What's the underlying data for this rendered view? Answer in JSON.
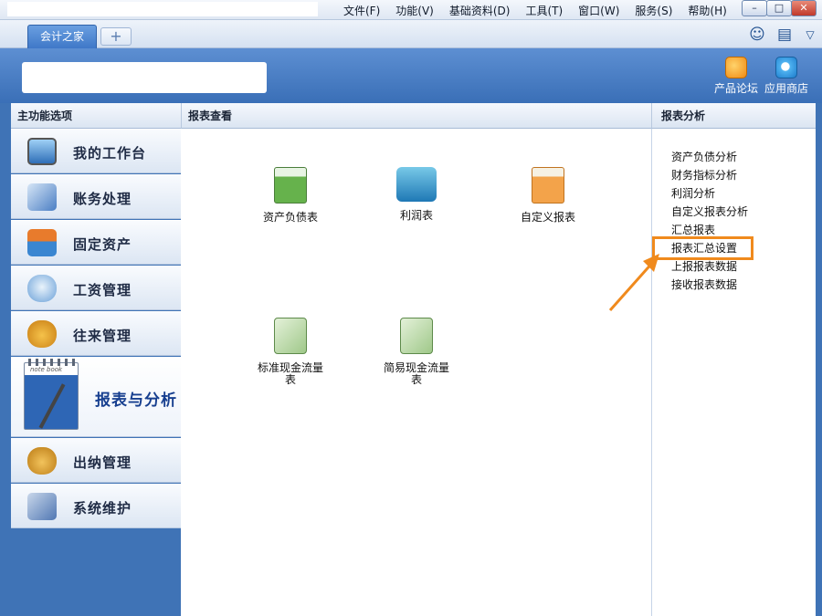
{
  "menubar": {
    "items": [
      "文件(F)",
      "功能(V)",
      "基础资料(D)",
      "工具(T)",
      "窗口(W)",
      "服务(S)",
      "帮助(H)"
    ]
  },
  "window_controls": {
    "minimize": "–",
    "maximize": "□",
    "close": "✕"
  },
  "tabbar": {
    "active_tab": "会计之家",
    "add_tab": "+",
    "icons": [
      "smiley-icon",
      "message-icon",
      "dropdown-icon"
    ]
  },
  "header": {
    "buttons": [
      {
        "label": "产品论坛",
        "icon": "forum-icon"
      },
      {
        "label": "应用商店",
        "icon": "app-store-icon"
      }
    ]
  },
  "panels": {
    "left_title": "主功能选项",
    "center_title": "报表查看",
    "right_title": "报表分析"
  },
  "sidebar": {
    "items": [
      {
        "label": "我的工作台",
        "icon": "monitor-icon"
      },
      {
        "label": "账务处理",
        "icon": "ledger-icon"
      },
      {
        "label": "固定资产",
        "icon": "house-icon"
      },
      {
        "label": "工资管理",
        "icon": "cloud-icon"
      },
      {
        "label": "往来管理",
        "icon": "money-bag-icon"
      }
    ],
    "active": {
      "label": "报表与分析",
      "notebook_text": "note book"
    },
    "items_after": [
      {
        "label": "出纳管理",
        "icon": "money-sack-icon"
      },
      {
        "label": "系统维护",
        "icon": "toolbox-icon"
      }
    ]
  },
  "reports": [
    {
      "label": "资产负债表",
      "icon": "balance-sheet-icon"
    },
    {
      "label": "利润表",
      "icon": "profit-icon"
    },
    {
      "label": "自定义报表",
      "icon": "custom-report-icon"
    },
    {
      "label": "标准现金流量表",
      "icon": "cash-flow-icon"
    },
    {
      "label": "简易现金流量表",
      "icon": "simple-cash-flow-icon"
    }
  ],
  "analysis": {
    "items": [
      "资产负债分析",
      "财务指标分析",
      "利润分析",
      "自定义报表分析",
      "汇总报表",
      "报表汇总设置",
      "上报报表数据",
      "接收报表数据"
    ],
    "highlighted": "报表汇总设置"
  },
  "colors": {
    "highlight": "#f08a1d",
    "header_blue": "#3f73b6"
  }
}
